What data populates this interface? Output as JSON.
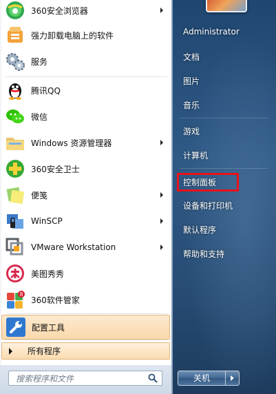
{
  "programs": [
    {
      "label": "360安全浏览器",
      "icon": "browser-360-icon",
      "has_submenu": true
    },
    {
      "label": "强力卸载电脑上的软件",
      "icon": "uninstall-icon",
      "has_submenu": false
    },
    {
      "label": "服务",
      "icon": "services-gears-icon",
      "has_submenu": false
    },
    {
      "label": "腾讯QQ",
      "icon": "qq-penguin-icon",
      "has_submenu": false
    },
    {
      "label": "微信",
      "icon": "wechat-icon",
      "has_submenu": false
    },
    {
      "label": "Windows 资源管理器",
      "icon": "explorer-folder-icon",
      "has_submenu": true
    },
    {
      "label": "360安全卫士",
      "icon": "security-360-icon",
      "has_submenu": false
    },
    {
      "label": "便笺",
      "icon": "sticky-notes-icon",
      "has_submenu": true
    },
    {
      "label": "WinSCP",
      "icon": "winscp-icon",
      "has_submenu": true
    },
    {
      "label": "VMware Workstation",
      "icon": "vmware-icon",
      "has_submenu": true
    },
    {
      "label": "美图秀秀",
      "icon": "meitu-icon",
      "has_submenu": false
    },
    {
      "label": "360软件管家",
      "icon": "software-manager-360-icon",
      "has_submenu": false
    },
    {
      "label": "配置工具",
      "icon": "config-tool-wrench-icon",
      "has_submenu": false,
      "highlighted": true
    }
  ],
  "all_programs": "所有程序",
  "search": {
    "placeholder": "搜索程序和文件"
  },
  "right_menu": [
    {
      "label": "Administrator"
    },
    {
      "label": "文档"
    },
    {
      "label": "图片"
    },
    {
      "label": "音乐"
    },
    {
      "label": "游戏"
    },
    {
      "label": "计算机"
    },
    {
      "label": "控制面板",
      "annotated": true
    },
    {
      "label": "设备和打印机"
    },
    {
      "label": "默认程序"
    },
    {
      "label": "帮助和支持"
    }
  ],
  "shutdown": {
    "label": "关机"
  },
  "colors": {
    "annotation": "#e8121b",
    "highlight": "#fbd9ab",
    "panel": "#2b4e78"
  }
}
